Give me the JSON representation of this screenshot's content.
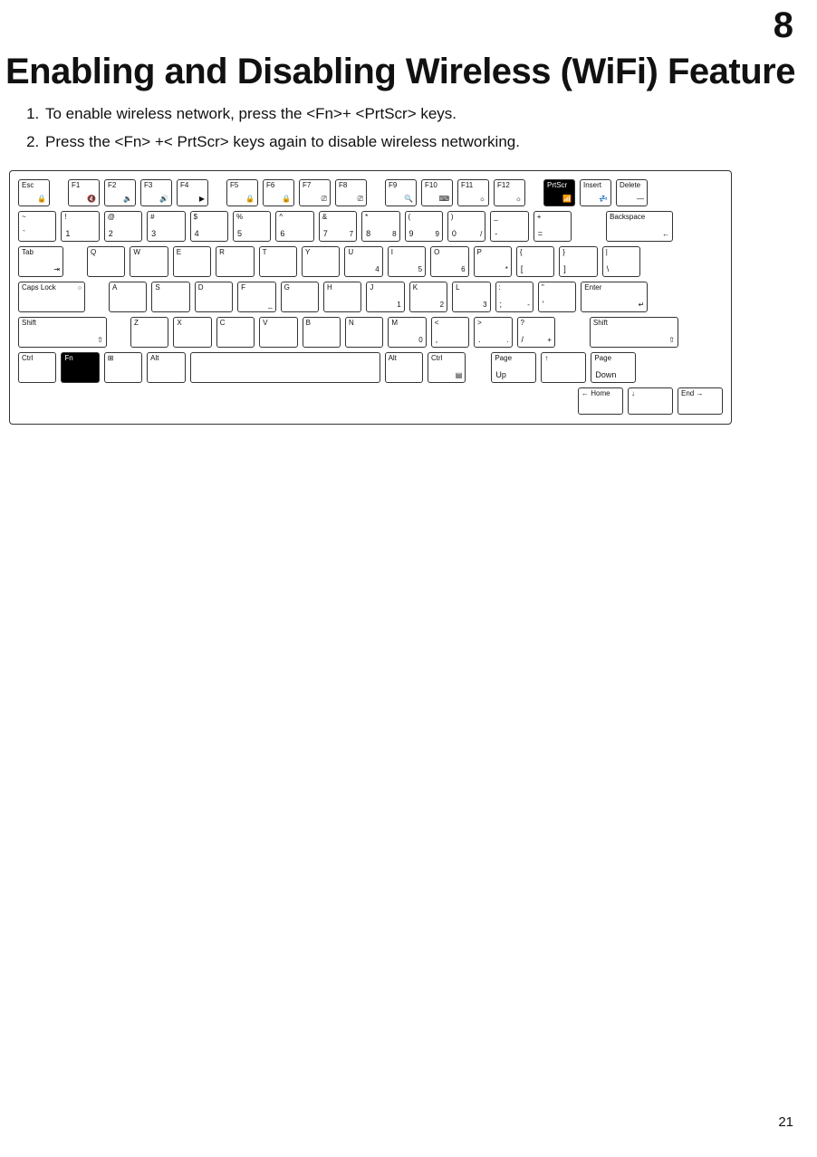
{
  "chapter_number": "8",
  "page_title": "Enabling and Disabling Wireless (WiFi) Feature",
  "steps": [
    "To enable wireless network, press the <Fn>+ <PrtScr> keys.",
    "Press the <Fn> +< PrtScr> keys again to disable wireless networking."
  ],
  "page_number": "21",
  "keyboard": {
    "row0": [
      {
        "tl": "Esc",
        "br": "🔒"
      },
      {
        "tl": "F1",
        "br": "🔇"
      },
      {
        "tl": "F2",
        "br": "🔉"
      },
      {
        "tl": "F3",
        "br": "🔊"
      },
      {
        "tl": "F4",
        "br": "▶"
      },
      {
        "tl": "F5",
        "br": "🔒"
      },
      {
        "tl": "F6",
        "br": "🔒"
      },
      {
        "tl": "F7",
        "br": "⎚"
      },
      {
        "tl": "F8",
        "br": "⎚"
      },
      {
        "tl": "F9",
        "br": "🔍"
      },
      {
        "tl": "F10",
        "br": "⌨"
      },
      {
        "tl": "F11",
        "br": "☼"
      },
      {
        "tl": "F12",
        "br": "☼"
      },
      {
        "tl": "PrtScr",
        "br": "📶",
        "dark": true
      },
      {
        "tl": "Insert",
        "br": "💤"
      },
      {
        "tl": "Delete",
        "br": "—"
      }
    ],
    "row1": [
      {
        "tl": "~",
        "bl": "`"
      },
      {
        "tl": "!",
        "bl": "1"
      },
      {
        "tl": "@",
        "bl": "2"
      },
      {
        "tl": "#",
        "bl": "3"
      },
      {
        "tl": "$",
        "bl": "4"
      },
      {
        "tl": "%",
        "bl": "5"
      },
      {
        "tl": "^",
        "bl": "6"
      },
      {
        "tl": "&",
        "bl": "7",
        "br": "7"
      },
      {
        "tl": "*",
        "bl": "8",
        "br": "8"
      },
      {
        "tl": "(",
        "bl": "9",
        "br": "9"
      },
      {
        "tl": ")",
        "bl": "0",
        "br": "/"
      },
      {
        "tl": "_",
        "bl": "-"
      },
      {
        "tl": "+",
        "bl": "="
      },
      {
        "tl": "Backspace",
        "br": "←",
        "cls": "bksp"
      }
    ],
    "row2": [
      {
        "tl": "Tab",
        "br": "⇥",
        "cls": "tab"
      },
      {
        "tl": "Q"
      },
      {
        "tl": "W"
      },
      {
        "tl": "E"
      },
      {
        "tl": "R"
      },
      {
        "tl": "T"
      },
      {
        "tl": "Y"
      },
      {
        "tl": "U",
        "br": "4"
      },
      {
        "tl": "I",
        "br": "5"
      },
      {
        "tl": "O",
        "br": "6"
      },
      {
        "tl": "P",
        "br": "*"
      },
      {
        "tl": "{",
        "bl": "["
      },
      {
        "tl": "}",
        "bl": "]"
      },
      {
        "tl": "|",
        "bl": "\\"
      }
    ],
    "row3": [
      {
        "tl": "Caps Lock",
        "tr": "○",
        "cls": "caps"
      },
      {
        "tl": "A"
      },
      {
        "tl": "S"
      },
      {
        "tl": "D"
      },
      {
        "tl": "F",
        "br": "_"
      },
      {
        "tl": "G"
      },
      {
        "tl": "H"
      },
      {
        "tl": "J",
        "br": "1"
      },
      {
        "tl": "K",
        "br": "2"
      },
      {
        "tl": "L",
        "br": "3"
      },
      {
        "tl": ":",
        "bl": ";",
        "br": "-"
      },
      {
        "tl": "\"",
        "bl": "'"
      },
      {
        "tl": "Enter",
        "br": "↵",
        "cls": "enter"
      }
    ],
    "row4": [
      {
        "tl": "Shift",
        "br": "⇧",
        "cls": "shift"
      },
      {
        "tl": "Z"
      },
      {
        "tl": "X"
      },
      {
        "tl": "C"
      },
      {
        "tl": "V"
      },
      {
        "tl": "B"
      },
      {
        "tl": "N"
      },
      {
        "tl": "M",
        "br": "0"
      },
      {
        "tl": "<",
        "bl": ","
      },
      {
        "tl": ">",
        "bl": ".",
        "br": "."
      },
      {
        "tl": "?",
        "bl": "/",
        "br": "+"
      },
      {
        "tl": "Shift",
        "br": "⇧",
        "cls": "shift-r"
      }
    ],
    "row5_left": [
      {
        "tl": "Ctrl"
      },
      {
        "tl": "Fn",
        "dark": true
      },
      {
        "tl": "⊞"
      },
      {
        "tl": "Alt"
      }
    ],
    "row5_right": [
      {
        "tl": "Alt"
      },
      {
        "tl": "Ctrl",
        "br": "▤"
      },
      {
        "tl": "Page",
        "bl": "Up",
        "cls": "narrow"
      },
      {
        "tl": "↑",
        "cls": "narrow arrow"
      },
      {
        "tl": "Page",
        "bl": "Down",
        "cls": "narrow"
      }
    ],
    "row6": [
      {
        "tl": "← Home",
        "cls": ""
      },
      {
        "tl": "↓",
        "cls": "arrow"
      },
      {
        "tl": "End →",
        "cls": ""
      }
    ]
  }
}
